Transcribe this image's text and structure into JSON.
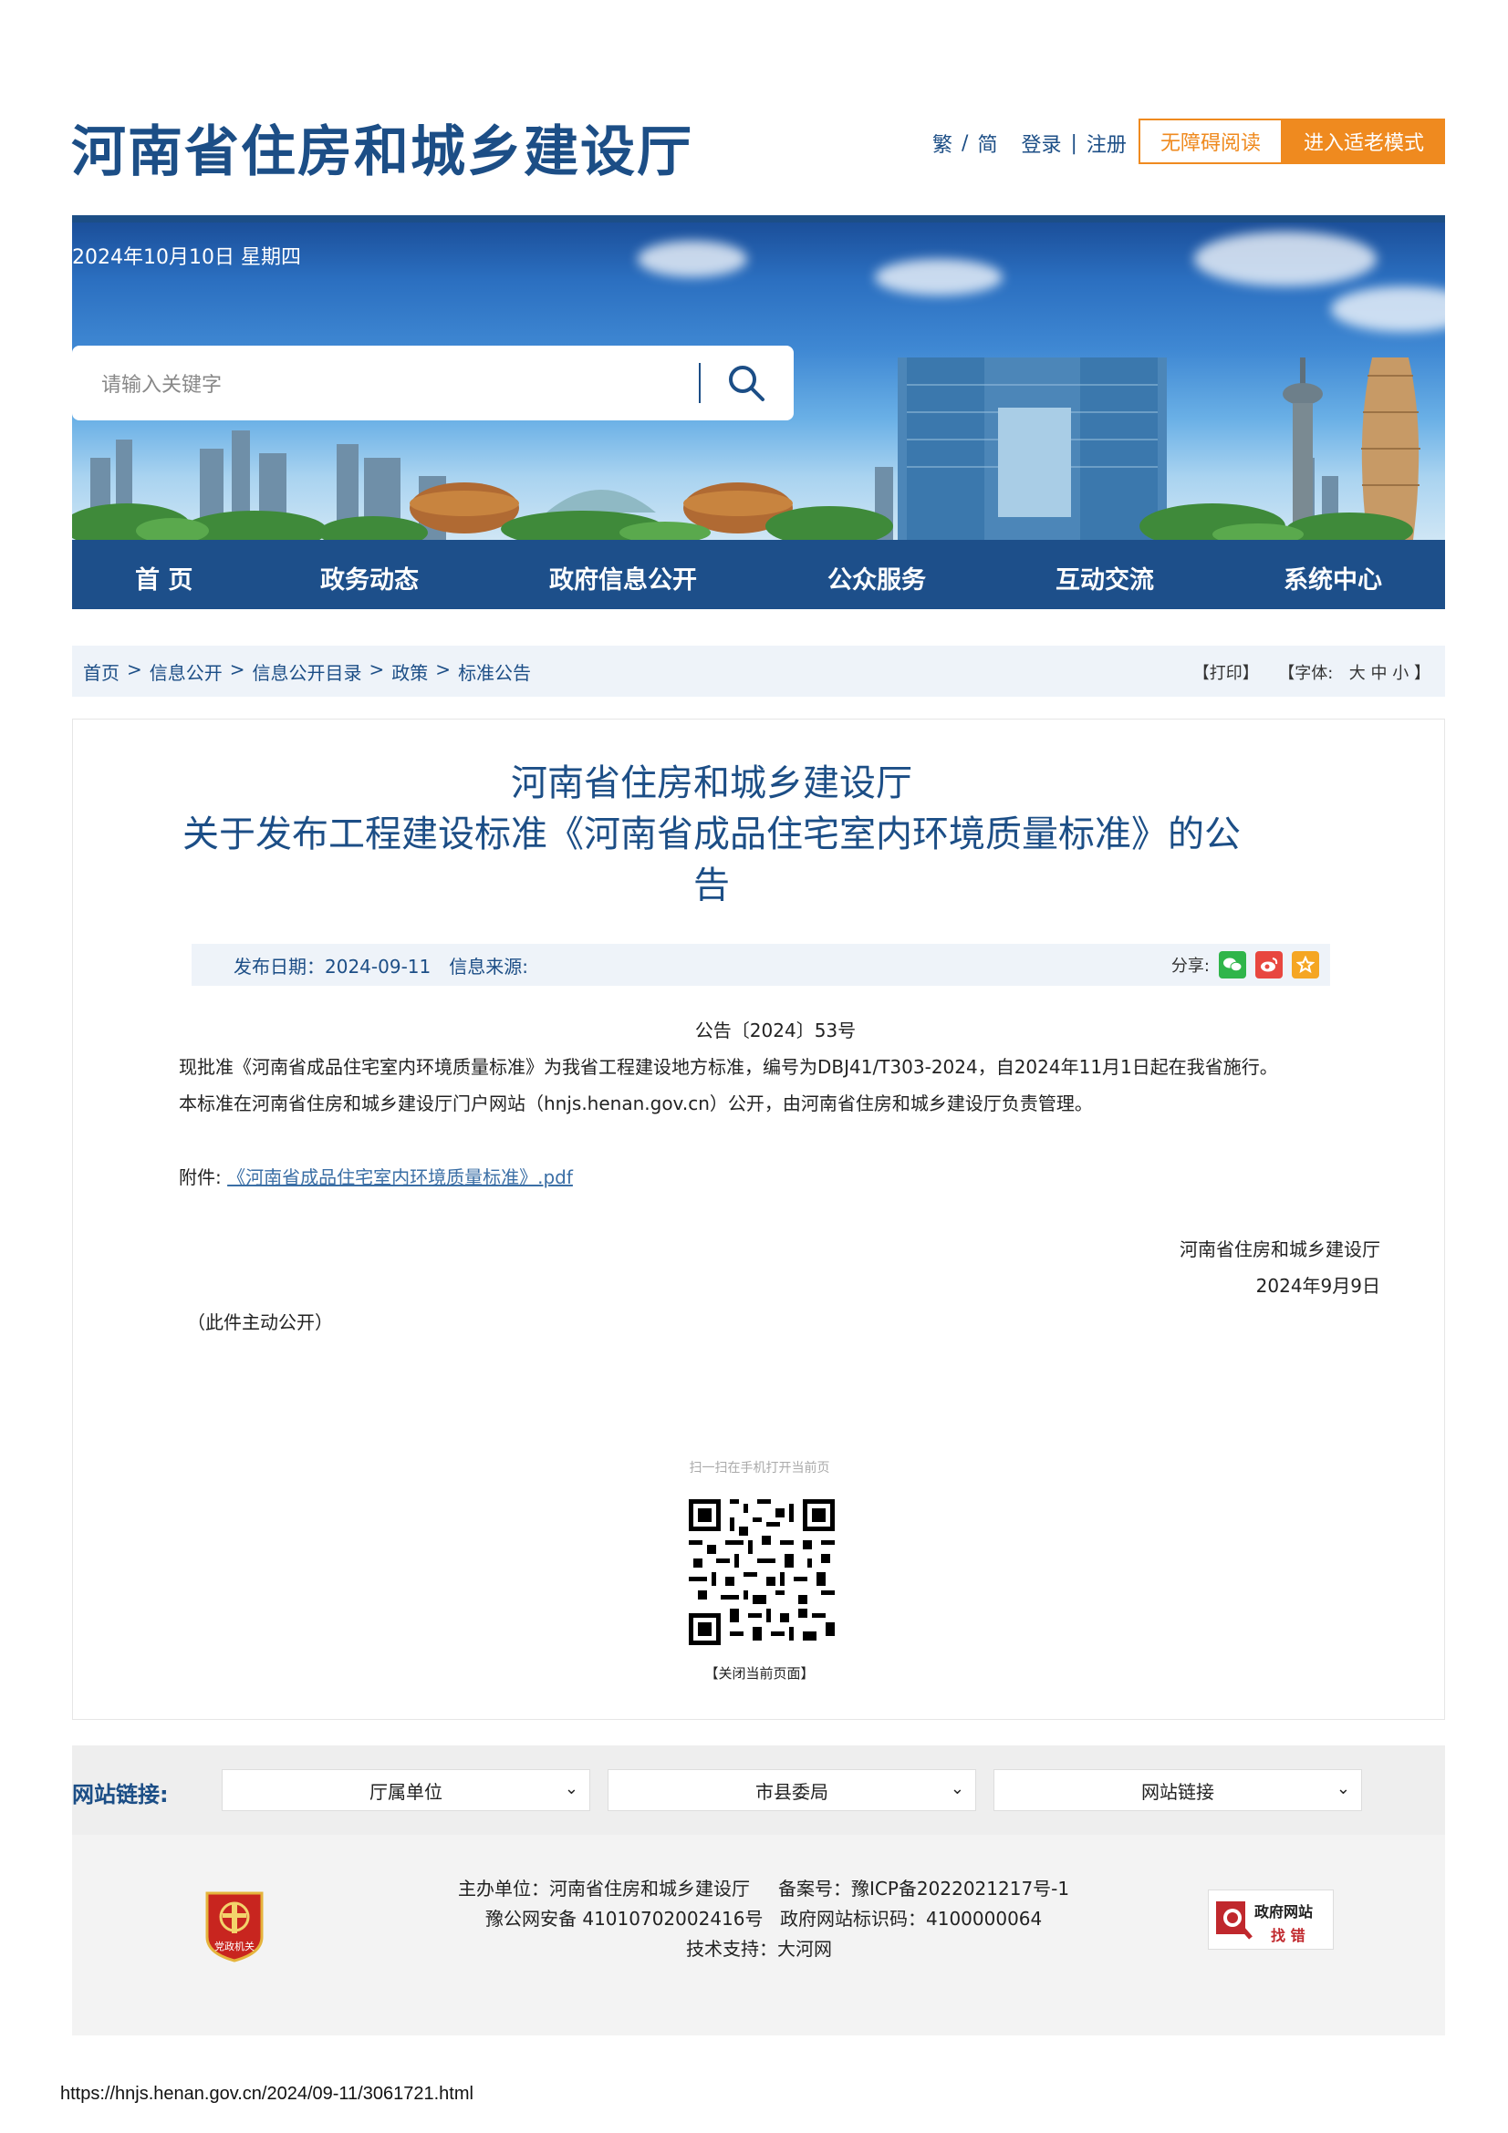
{
  "header": {
    "site_title": "河南省住房和城乡建设厅",
    "lang_trad": "繁",
    "lang_sep": "/",
    "lang_simp": "简",
    "login": "登录",
    "login_sep": "|",
    "register": "注册",
    "accessible_btn": "无障碍阅读",
    "elder_btn": "进入适老模式"
  },
  "banner": {
    "date": "2024年10月10日 星期四",
    "search_placeholder": "请输入关键字"
  },
  "nav": {
    "items": [
      "首 页",
      "政务动态",
      "政府信息公开",
      "公众服务",
      "互动交流",
      "系统中心"
    ]
  },
  "breadcrumb": {
    "items": [
      "首页",
      "信息公开",
      "信息公开目录",
      "政策",
      "标准公告"
    ],
    "sep": ">",
    "print": "【打印】",
    "font_label": "【字体:",
    "font_large": "大",
    "font_medium": "中",
    "font_small": "小",
    "font_end": "】"
  },
  "article": {
    "title_line1": "河南省住房和城乡建设厅",
    "title_line2": "关于发布工程建设标准《河南省成品住宅室内环境质量标准》的公",
    "title_line3": "告",
    "publish_date": "发布日期：2024-09-11",
    "source": "信息来源:",
    "share_label": "分享:",
    "doc_no": "公告〔2024〕53号",
    "para1": "现批准《河南省成品住宅室内环境质量标准》为我省工程建设地方标准，编号为DBJ41/T303-2024，自2024年11月1日起在我省施行。",
    "para2": "本标准在河南省住房和城乡建设厅门户网站（hnjs.henan.gov.cn）公开，由河南省住房和城乡建设厅负责管理。",
    "attach_label": "附件:",
    "attach_link": "《河南省成品住宅室内环境质量标准》.pdf",
    "sign_org": "河南省住房和城乡建设厅",
    "sign_date": "2024年9月9日",
    "public_note": "（此件主动公开）",
    "qr_caption": "扫一扫在手机打开当前页",
    "close_page": "【关闭当前页面】"
  },
  "links": {
    "label": "网站链接:",
    "selects": [
      "厅属单位",
      "市县委局",
      "网站链接"
    ]
  },
  "footer": {
    "host": "主办单位：河南省住房和城乡建设厅",
    "icp": "备案号：豫ICP备2022021217号-1",
    "police": "豫公网安备 41010702002416号",
    "site_id": "政府网站标识码：4100000064",
    "tech": "技术支持：大河网",
    "badge_text": "党政机关",
    "findbug_1": "政府网站",
    "findbug_2": "找 错"
  },
  "page_url": "https://hnjs.henan.gov.cn/2024/09-11/3061721.html",
  "colors": {
    "brand_blue": "#1c4e86",
    "accent_orange": "#ef8a1f"
  }
}
